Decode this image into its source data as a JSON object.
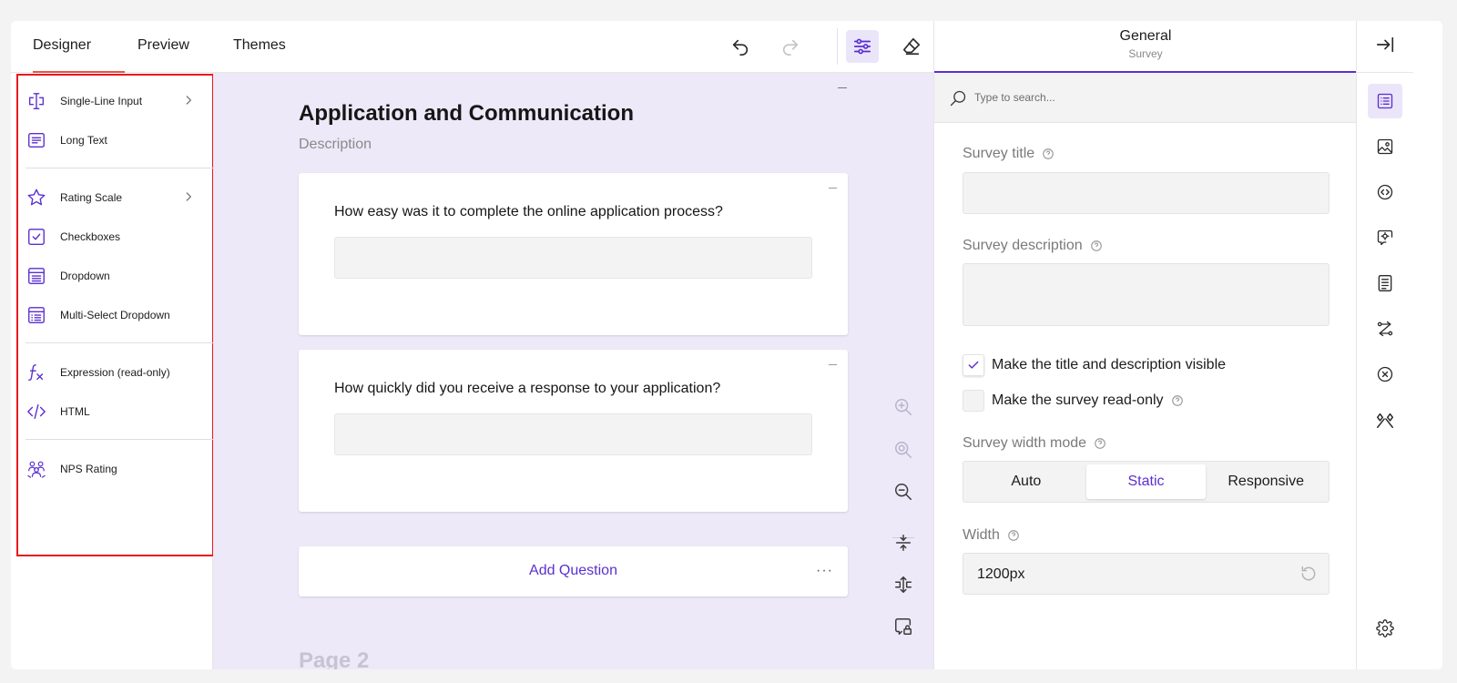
{
  "tabs": [
    {
      "label": "Designer",
      "active": true
    },
    {
      "label": "Preview",
      "active": false
    },
    {
      "label": "Themes",
      "active": false
    }
  ],
  "toolbar": {
    "undo_icon": "undo-icon",
    "redo_icon": "redo-icon",
    "settings_icon": "sliders-icon",
    "clear_icon": "eraser-icon"
  },
  "toolbox": {
    "items": [
      {
        "label": "Single-Line Input",
        "icon": "text-cursor-icon",
        "has_submenu": true
      },
      {
        "label": "Long Text",
        "icon": "long-text-icon",
        "has_submenu": false
      },
      {
        "label": "Rating Scale",
        "icon": "star-icon",
        "has_submenu": true
      },
      {
        "label": "Checkboxes",
        "icon": "checkbox-icon",
        "has_submenu": false
      },
      {
        "label": "Dropdown",
        "icon": "dropdown-icon",
        "has_submenu": false
      },
      {
        "label": "Multi-Select Dropdown",
        "icon": "multi-select-icon",
        "has_submenu": false
      },
      {
        "label": "Expression (read-only)",
        "icon": "function-icon",
        "has_submenu": false
      },
      {
        "label": "HTML",
        "icon": "code-icon",
        "has_submenu": false
      },
      {
        "label": "NPS Rating",
        "icon": "nps-icon",
        "has_submenu": false
      }
    ]
  },
  "survey": {
    "page_title": "Application and Communication",
    "page_description": "Description",
    "questions": [
      {
        "title": "How easy was it to complete the online application process?"
      },
      {
        "title": "How quickly did you receive a response to your application?"
      }
    ],
    "add_question_label": "Add Question",
    "more_label": "···",
    "next_page_title": "Page 2"
  },
  "panel": {
    "title": "General",
    "subtitle": "Survey",
    "search_placeholder": "Type to search...",
    "survey_title_label": "Survey title",
    "survey_title_value": "",
    "survey_description_label": "Survey description",
    "survey_description_value": "",
    "title_visible_label": "Make the title and description visible",
    "title_visible_checked": true,
    "read_only_label": "Make the survey read-only",
    "read_only_checked": false,
    "width_mode_label": "Survey width mode",
    "width_mode_options": [
      "Auto",
      "Static",
      "Responsive"
    ],
    "width_mode_selected": "Static",
    "width_label": "Width",
    "width_value": "1200px"
  },
  "colors": {
    "accent": "#5b2fd0",
    "canvas_bg": "#ede9f8",
    "highlight_border": "#e8191e",
    "tab_underline": "#e5534b"
  }
}
